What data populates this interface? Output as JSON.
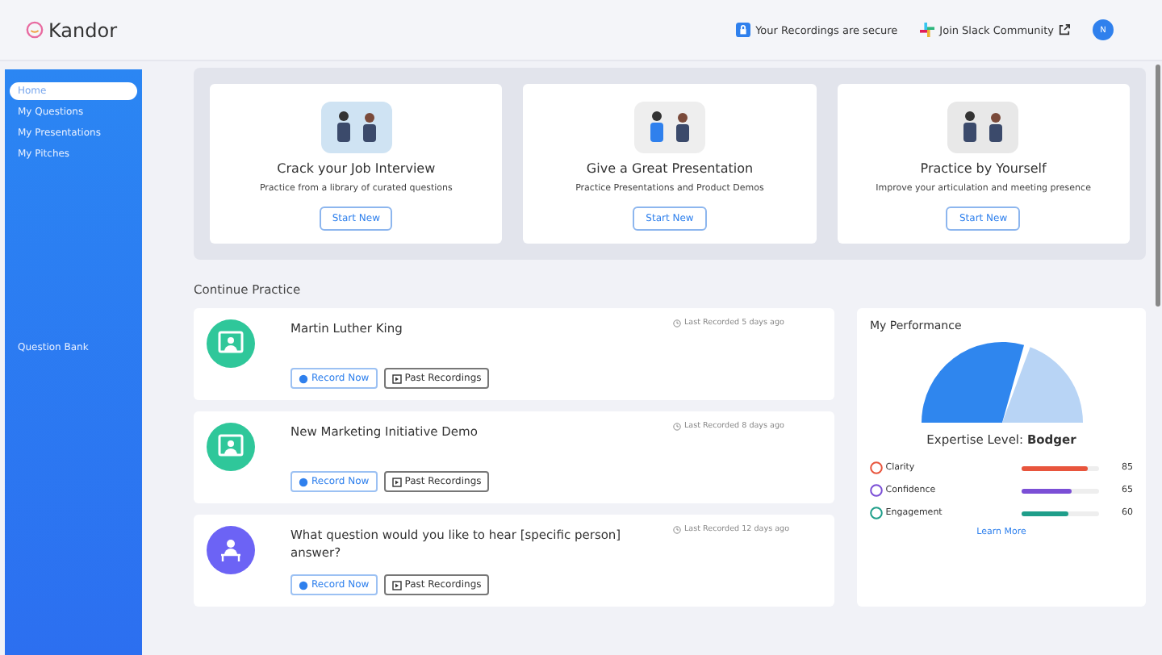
{
  "header": {
    "logo": "Kandor",
    "secure": "Your Recordings are secure",
    "community": "Join Slack Community",
    "avatar": "N"
  },
  "sidebar": {
    "items": [
      {
        "label": "Home",
        "selected": true
      },
      {
        "label": "My Questions",
        "selected": false
      },
      {
        "label": "My Presentations",
        "selected": false
      },
      {
        "label": "My Pitches",
        "selected": false
      }
    ],
    "bottom_item": {
      "label": "Question Bank",
      "selected": false
    }
  },
  "practice_cards": [
    {
      "kind": "interview",
      "title": "Crack your Job Interview",
      "subtitle": "Practice from a library of curated questions",
      "button": "Start New"
    },
    {
      "kind": "presentation",
      "title": "Give a Great Presentation",
      "subtitle": "Practice Presentations and Product Demos",
      "button": "Start New"
    },
    {
      "kind": "solo",
      "title": "Practice by Yourself",
      "subtitle": "Improve your articulation and meeting presence",
      "button": "Start New"
    }
  ],
  "continue_title": "Continue Practice",
  "sessions": [
    {
      "kind": "presentation",
      "color": "#2fc79a",
      "title": "Martin Luther King",
      "last": "Last Recorded 5 days ago",
      "record": "Record Now",
      "past": "Past Recordings"
    },
    {
      "kind": "presentation",
      "color": "#2fc79a",
      "title": "New Marketing Initiative Demo",
      "last": "Last Recorded 8 days ago",
      "record": "Record Now",
      "past": "Past Recordings"
    },
    {
      "kind": "question",
      "color": "#6c63f5",
      "title": "What question would you like to hear [specific person] answer?",
      "last": "Last Recorded 12 days ago",
      "record": "Record Now",
      "past": "Past Recordings"
    }
  ],
  "performance": {
    "title": "My Performance",
    "expertise_label": "Expertise Level:",
    "expertise_value": "Bodger",
    "metrics": [
      {
        "name": "Clarity",
        "value": "85",
        "level": 0.85,
        "color": "#e8553d"
      },
      {
        "name": "Confidence",
        "value": "65",
        "level": 0.65,
        "color": "#7b4fd6"
      },
      {
        "name": "Engagement",
        "value": "60",
        "level": 0.6,
        "color": "#1f9e8a"
      }
    ],
    "link": "Learn More"
  }
}
